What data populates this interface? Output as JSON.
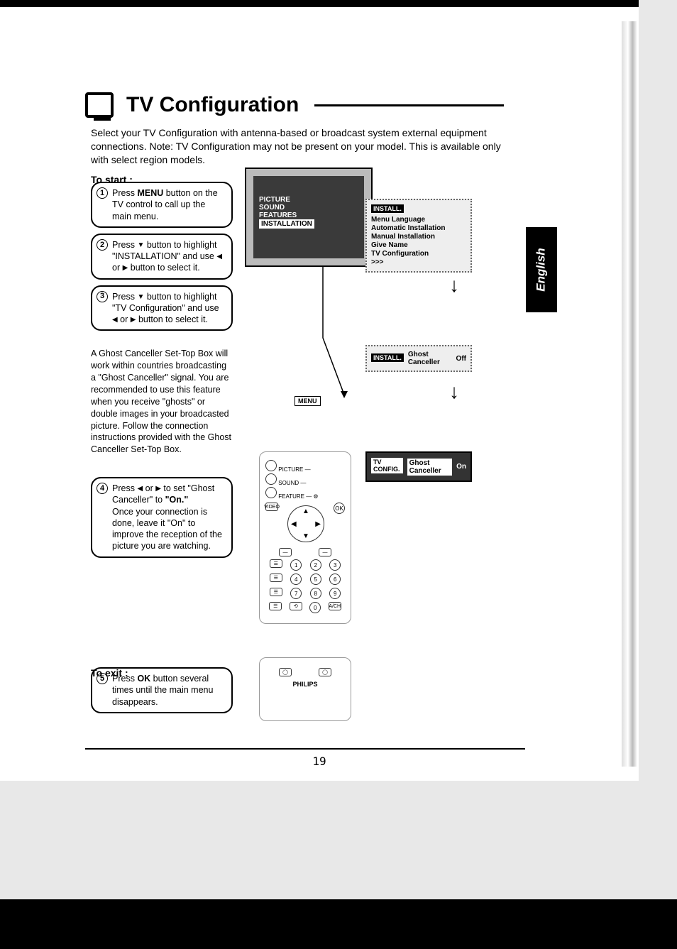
{
  "title": "TV Configuration",
  "intro": "Select your TV Configuration with antenna-based or broadcast system external equipment connections. Note: TV Configuration may not be present on your model. This is available only with select region models.",
  "labels": {
    "to_start": "To start :",
    "to_exit": "To exit :",
    "language_tab": "English"
  },
  "steps": [
    {
      "n": "1",
      "html": "Press <b>MENU</b> button on the TV control to call up the main menu."
    },
    {
      "n": "2",
      "html": "Press <span class='tri'>▼</span> button to highlight \"INSTALLATION\" and use <span class='tri'>◀</span> or <span class='tri'>▶</span> button to select it."
    },
    {
      "n": "3",
      "html": "Press <span class='tri'>▼</span> button to highlight \"TV Configuration\" and use <span class='tri'>◀</span> or <span class='tri'>▶</span> button to select it."
    }
  ],
  "ghost_paragraph": "A Ghost Canceller Set-Top Box will work within countries broadcasting a \"Ghost Canceller\" signal. You are recommended to use this feature when you receive \"ghosts\" or double images in your broadcasted picture. Follow the connection instructions provided with the Ghost Canceller Set-Top Box.",
  "step4": {
    "n": "4",
    "html": "Press <span class='tri'>◀</span> or <span class='tri'>▶</span> to set \"Ghost Canceller\" to <b>\"On.\"</b><br>Once your connection is done, leave it \"On\" to improve the reception of the picture you are watching."
  },
  "step5": {
    "n": "5",
    "html": "Press <b>OK</b> button several times until the main menu disappears."
  },
  "tv_menu1": {
    "items": [
      "PICTURE",
      "SOUND",
      "FEATURES"
    ],
    "selected": "INSTALLATION"
  },
  "install_menu": {
    "header": "INSTALL.",
    "items": [
      "Menu Language",
      "Automatic Installation",
      "Manual Installation",
      "Give Name",
      "TV Configuration"
    ],
    "arrows": ">>>"
  },
  "ghost_panel_off": {
    "header": "INSTALL.",
    "label": "Ghost Canceller",
    "value": "Off"
  },
  "ghost_panel_on": {
    "header": "TV CONFIG.",
    "label": "Ghost Canceller",
    "value": "On"
  },
  "remote": {
    "menu_btn": "MENU",
    "labels": [
      "PICTURE",
      "SOUND",
      "FEATURE"
    ],
    "video": "VIDEO",
    "ok": "OK",
    "keypad": [
      "1",
      "2",
      "3",
      "4",
      "5",
      "6",
      "7",
      "8",
      "9",
      "0"
    ],
    "brand": "PHILIPS"
  },
  "page_number": "19"
}
